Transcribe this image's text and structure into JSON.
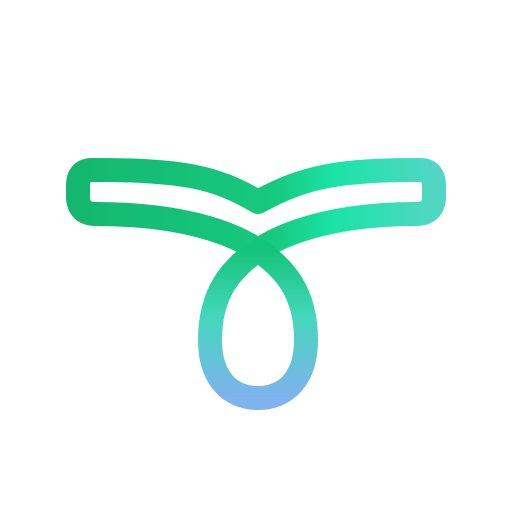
{
  "app_icon": {
    "icon": "stylized-t-loop-logo-icon",
    "colors": {
      "background": "#ffffff",
      "primary_green": "#13B86E",
      "mint": "#19E4A6",
      "teal": "#52D6C4",
      "light_blue": "#7FB2EE"
    }
  }
}
